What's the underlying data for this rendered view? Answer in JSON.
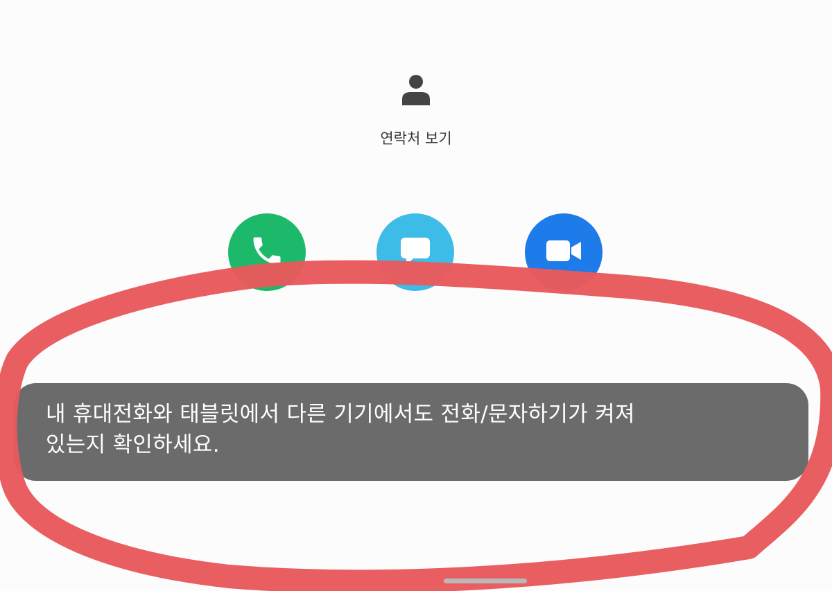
{
  "contact": {
    "icon": "person-icon",
    "view_label": "연락처 보기"
  },
  "actions": [
    {
      "name": "call",
      "icon": "phone-icon",
      "color": "#1cb96a"
    },
    {
      "name": "message",
      "icon": "message-bubble-icon",
      "color": "#3cbce6"
    },
    {
      "name": "video",
      "icon": "video-camera-icon",
      "color": "#1e7bea"
    }
  ],
  "toast": {
    "line1": "내 휴대전화와 태블릿에서 다른 기기에서도 전화/문자하기가 켜져",
    "line2": "있는지 확인하세요.",
    "background": "#6b6b6b"
  },
  "annotation": {
    "shape": "hand-drawn ellipse",
    "color": "#e85a5c"
  }
}
